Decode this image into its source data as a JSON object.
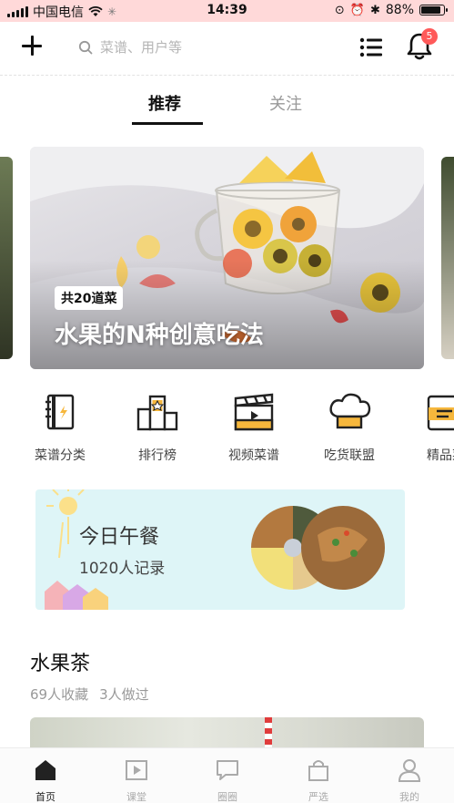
{
  "status_bar": {
    "carrier": "中国电信",
    "time": "14:39",
    "battery_percent": "88%",
    "battery_level": 0.88
  },
  "top_bar": {
    "search_placeholder": "菜谱、用户等",
    "notification_count": "5"
  },
  "tabs": [
    {
      "label": "推荐",
      "active": true
    },
    {
      "label": "关注",
      "active": false
    }
  ],
  "banner": {
    "tag": "共20道菜",
    "title": "水果的N种创意吃法"
  },
  "categories": [
    {
      "label": "菜谱分类",
      "icon": "recipe-book-icon"
    },
    {
      "label": "排行榜",
      "icon": "ranking-podium-icon"
    },
    {
      "label": "视频菜谱",
      "icon": "video-clapper-icon"
    },
    {
      "label": "吃货联盟",
      "icon": "chef-hat-icon"
    },
    {
      "label": "精品菜",
      "icon": "premium-card-icon"
    }
  ],
  "lunch_card": {
    "title": "今日午餐",
    "subtitle": "1020人记录"
  },
  "recipe": {
    "title": "水果茶",
    "favorites": "69人收藏",
    "made": "3人做过"
  },
  "bottom_nav": [
    {
      "label": "首页",
      "icon": "home-icon",
      "active": true
    },
    {
      "label": "课堂",
      "icon": "classroom-play-icon",
      "active": false
    },
    {
      "label": "圈圈",
      "icon": "chat-bubble-icon",
      "active": false
    },
    {
      "label": "严选",
      "icon": "shopping-bag-icon",
      "active": false
    },
    {
      "label": "我的",
      "icon": "profile-icon",
      "active": false
    }
  ],
  "colors": {
    "accent_yellow": "#f6b73c",
    "badge_red": "#ff5a5a",
    "lunch_bg": "#def5f7"
  }
}
